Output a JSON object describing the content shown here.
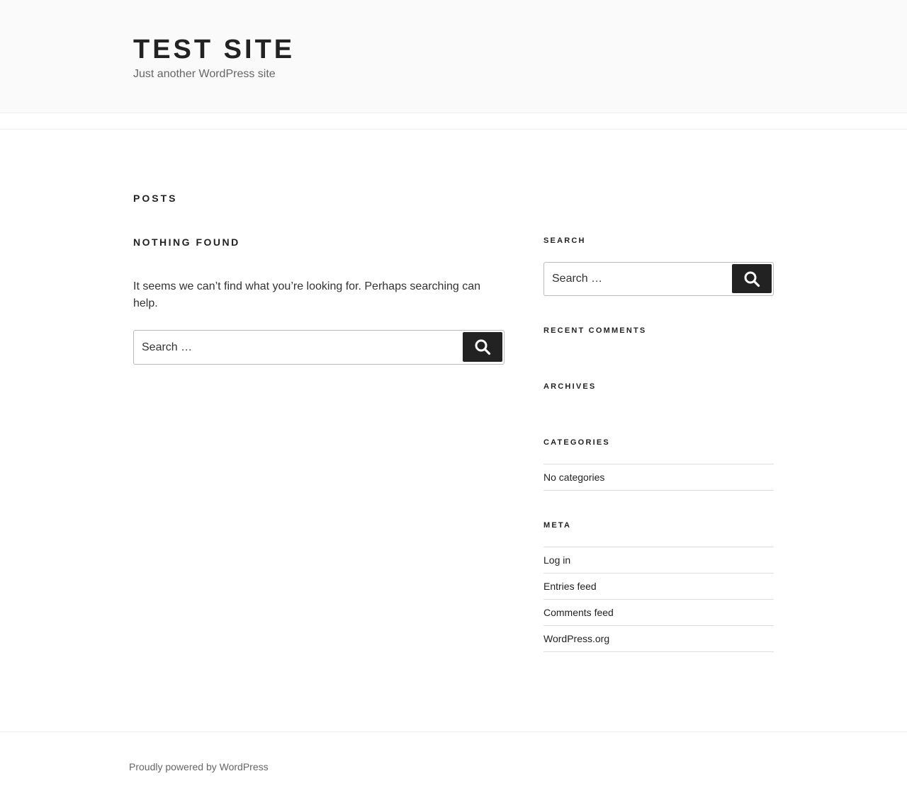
{
  "header": {
    "site_title": "TEST SITE",
    "site_description": "Just another WordPress site",
    "background": "#fafafa"
  },
  "main": {
    "page_title": "POSTS",
    "not_found_title": "NOTHING FOUND",
    "not_found_text": "It seems we can’t find what you’re looking for. Perhaps searching can help.",
    "search": {
      "placeholder": "Search …",
      "button_icon": "search-icon"
    }
  },
  "sidebar": {
    "search_widget": {
      "title": "SEARCH",
      "placeholder": "Search …",
      "button_icon": "search-icon"
    },
    "recent_comments": {
      "title": "RECENT COMMENTS"
    },
    "archives": {
      "title": "ARCHIVES"
    },
    "categories": {
      "title": "CATEGORIES",
      "items": [
        "No categories"
      ]
    },
    "meta": {
      "title": "META",
      "items": [
        "Log in",
        "Entries feed",
        "Comments feed",
        "WordPress.org"
      ]
    }
  },
  "footer": {
    "credit": "Proudly powered by WordPress"
  },
  "colors": {
    "text": "#222222",
    "button": "#222222",
    "muted": "#666666",
    "border": "#dddddd"
  }
}
